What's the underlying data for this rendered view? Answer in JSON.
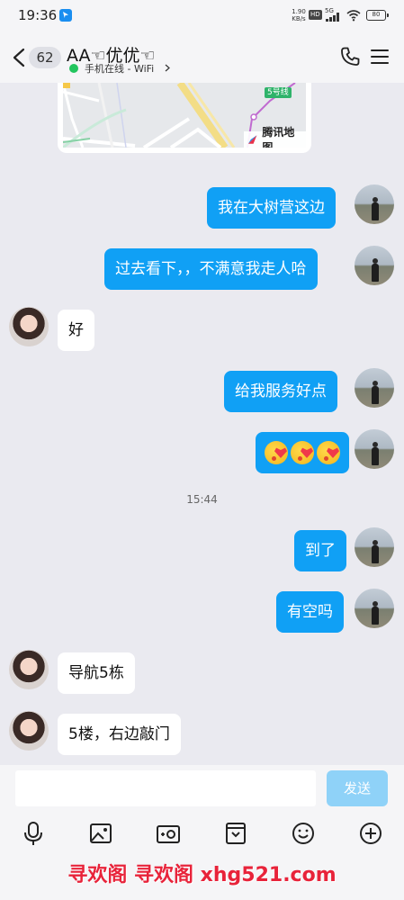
{
  "status_bar": {
    "time": "19:36",
    "net_speed_value": "1.90",
    "net_speed_unit": "KB/s",
    "hd_label": "HD",
    "network_label": "5G",
    "battery": "80"
  },
  "header": {
    "unread_count": "62",
    "contact_name": "AA☜优优☜",
    "online_status": "手机在线 - WiFi"
  },
  "map": {
    "line_label": "5号线",
    "provider": "腾讯地图"
  },
  "messages": [
    {
      "side": "out",
      "text": "我在大树营这边"
    },
    {
      "side": "out",
      "text": "过去看下，，不满意我走人哈"
    },
    {
      "side": "in",
      "text": "好"
    },
    {
      "side": "out",
      "text": "给我服务好点"
    },
    {
      "side": "out",
      "text": "[emoji x3]",
      "emoji": [
        "kissing-heart-emoji",
        "kissing-heart-emoji",
        "kissing-heart-emoji"
      ]
    },
    {
      "side": "out",
      "text": "到了"
    },
    {
      "side": "out",
      "text": "有空吗"
    },
    {
      "side": "in",
      "text": "导航5栋"
    },
    {
      "side": "in",
      "text": "5楼，右边敲门"
    }
  ],
  "timestamp": "15:44",
  "input": {
    "value": "",
    "send_label": "发送"
  },
  "toolbar": {
    "icons": [
      "microphone-icon",
      "image-icon",
      "camera-icon",
      "file-icon",
      "emoji-icon",
      "plus-icon"
    ]
  },
  "watermark": "寻欢阁 寻欢阁 xhg521.com",
  "colors": {
    "outgoing_bubble": "#10a0f5",
    "incoming_bubble": "#ffffff",
    "background": "#eaeaf0",
    "send_button": "#8fd2f8",
    "online_dot": "#22c55e",
    "watermark": "#e8233a"
  }
}
